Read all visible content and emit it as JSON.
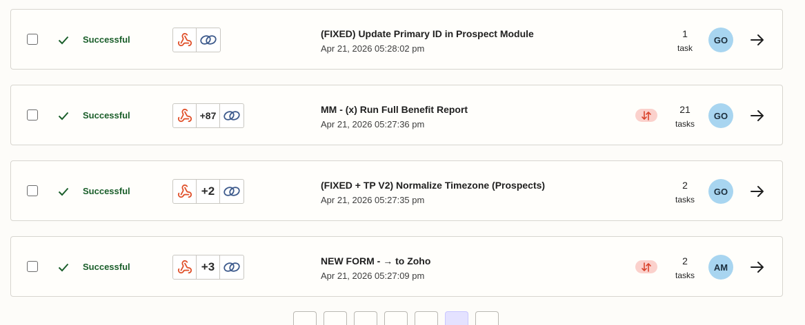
{
  "runs": [
    {
      "status": "Successful",
      "more_apps": "",
      "title": "(FIXED) Update Primary ID in Prospect Module",
      "date": "Apr 21, 2026 05:28:02 pm",
      "tasks_num": "1",
      "tasks_label": "task",
      "has_issue_badge": false,
      "avatar": "GO"
    },
    {
      "status": "Successful",
      "more_apps": "+87",
      "title": "MM - (x) Run Full Benefit Report",
      "date": "Apr 21, 2026 05:27:36 pm",
      "tasks_num": "21",
      "tasks_label": "tasks",
      "has_issue_badge": true,
      "avatar": "GO"
    },
    {
      "status": "Successful",
      "more_apps": "+2",
      "title": "(FIXED + TP V2) Normalize Timezone (Prospects)",
      "date": "Apr 21, 2026 05:27:35 pm",
      "tasks_num": "2",
      "tasks_label": "tasks",
      "has_issue_badge": false,
      "avatar": "GO"
    },
    {
      "status": "Successful",
      "more_apps": "+3",
      "title": "NEW FORM - → to Zoho",
      "date": "Apr 21, 2026 05:27:09 pm",
      "tasks_num": "2",
      "tasks_label": "tasks",
      "has_issue_badge": true,
      "avatar": "AM"
    }
  ],
  "icons": {
    "status": "check-icon",
    "trigger_app": "webhook-icon",
    "action_app": "link-chain-icon",
    "issue": "swap-arrows-icon",
    "open": "arrow-right-icon"
  },
  "colors": {
    "success_text": "#1a5e2a",
    "webhook_orange": "#e0512b",
    "link_blue": "#3d5a8c",
    "avatar_bg": "#a8d5f0",
    "issue_badge_bg": "#fbd1cc"
  },
  "pagination": {
    "active_index": 5
  }
}
